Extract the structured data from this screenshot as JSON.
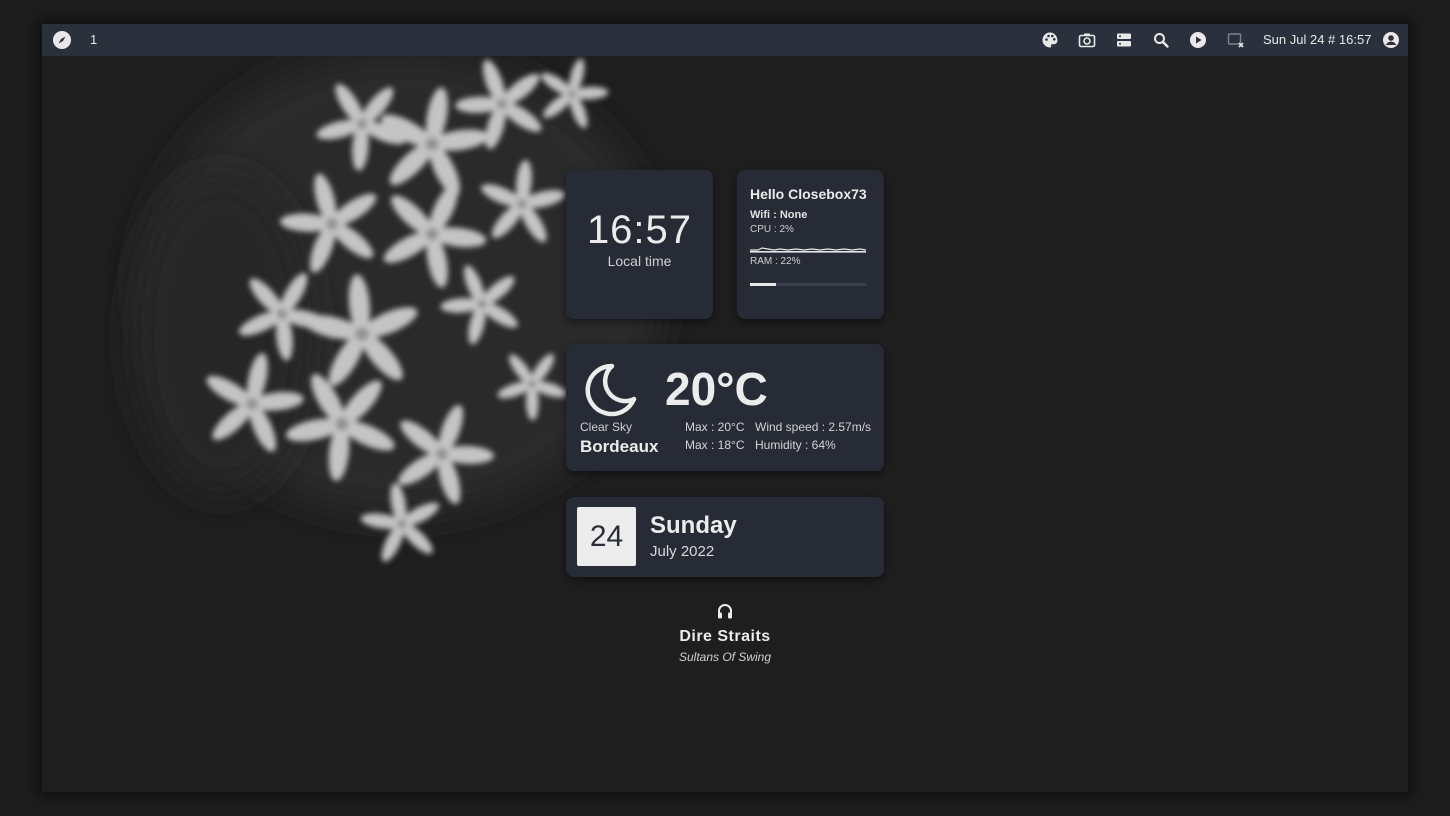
{
  "topbar": {
    "workspace": "1",
    "clock": "Sun Jul 24 # 16:57",
    "icons": [
      "compass-icon",
      "palette-icon",
      "camera-icon",
      "server-icon",
      "search-icon",
      "play-circle-icon",
      "screen-off-icon",
      "user-circle-icon"
    ]
  },
  "clock_widget": {
    "time": "16:57",
    "label": "Local time"
  },
  "system_widget": {
    "greeting": "Hello Closebox73",
    "wifi": "Wifi :  None",
    "cpu": "CPU : 2%",
    "ram": "RAM : 22%",
    "ram_fraction": 0.22
  },
  "weather_widget": {
    "icon": "moon-icon",
    "temperature": "20°C",
    "condition": "Clear Sky",
    "city": "Bordeaux",
    "max": "Max : 20°C",
    "min": "Max : 18°C",
    "wind": "Wind speed : 2.57m/s",
    "humidity": "Humidity : 64%"
  },
  "date_widget": {
    "day": "24",
    "weekday": "Sunday",
    "month_year": "July 2022"
  },
  "music_widget": {
    "icon": "headphones-icon",
    "artist": "Dire Straits",
    "track": "Sultans Of Swing"
  },
  "colors": {
    "panel": "#2b313c",
    "card": "#272b35",
    "background": "#1e1e1e",
    "foreground": "#ececec"
  }
}
